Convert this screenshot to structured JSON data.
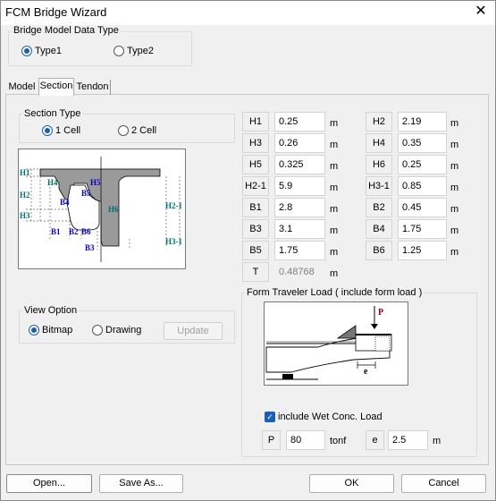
{
  "window": {
    "title": "FCM Bridge Wizard",
    "close": "✕"
  },
  "data_type": {
    "title": "Bridge Model Data Type",
    "options": [
      "Type1",
      "Type2"
    ],
    "selected": "Type1"
  },
  "tabs": [
    {
      "label": "Model"
    },
    {
      "label": "Section",
      "active": true
    },
    {
      "label": "Tendon"
    }
  ],
  "section_type": {
    "title": "Section Type",
    "options": [
      "1 Cell",
      "2 Cell"
    ],
    "selected": "1 Cell"
  },
  "section_diagram": {
    "labels": {
      "H1": "H1",
      "H2": "H2",
      "H3": "H3",
      "H4": "H4",
      "H5": "H5",
      "H6": "H6",
      "H2_1": "H2-1",
      "H3_1": "H3-1",
      "B1": "B1",
      "B2": "B2",
      "B3": "B3",
      "B4": "B4",
      "B5": "B5",
      "B6": "B6"
    }
  },
  "params": [
    {
      "label": "H1",
      "value": "0.25",
      "unit": "m"
    },
    {
      "label": "H2",
      "value": "2.19",
      "unit": "m"
    },
    {
      "label": "H3",
      "value": "0.26",
      "unit": "m"
    },
    {
      "label": "H4",
      "value": "0.35",
      "unit": "m"
    },
    {
      "label": "H5",
      "value": "0.325",
      "unit": "m"
    },
    {
      "label": "H6",
      "value": "0.25",
      "unit": "m"
    },
    {
      "label": "H2-1",
      "value": "5.9",
      "unit": "m"
    },
    {
      "label": "H3-1",
      "value": "0.85",
      "unit": "m"
    },
    {
      "label": "B1",
      "value": "2.8",
      "unit": "m"
    },
    {
      "label": "B2",
      "value": "0.45",
      "unit": "m"
    },
    {
      "label": "B3",
      "value": "3.1",
      "unit": "m"
    },
    {
      "label": "B4",
      "value": "1.75",
      "unit": "m"
    },
    {
      "label": "B5",
      "value": "1.75",
      "unit": "m"
    },
    {
      "label": "B6",
      "value": "1.25",
      "unit": "m"
    },
    {
      "label": "T",
      "value": "0.48768",
      "unit": "m",
      "readonly": true
    }
  ],
  "view_option": {
    "title": "View Option",
    "options": [
      "Bitmap",
      "Drawing"
    ],
    "selected": "Bitmap",
    "update": "Update"
  },
  "form_traveler": {
    "title": "Form Traveler Load ( include form load )",
    "diagram_P": "P",
    "diagram_e": "e",
    "wet_conc_label": "include Wet Conc. Load",
    "wet_conc_checked": true,
    "P": {
      "label": "P",
      "value": "80",
      "unit": "tonf"
    },
    "e": {
      "label": "e",
      "value": "2.5",
      "unit": "m"
    }
  },
  "buttons": {
    "open": "Open...",
    "save_as": "Save As...",
    "ok": "OK",
    "cancel": "Cancel"
  },
  "colors": {
    "accent": "#1a5fb4",
    "dim_label": "#0000cc",
    "dim_label_green": "#007070"
  }
}
